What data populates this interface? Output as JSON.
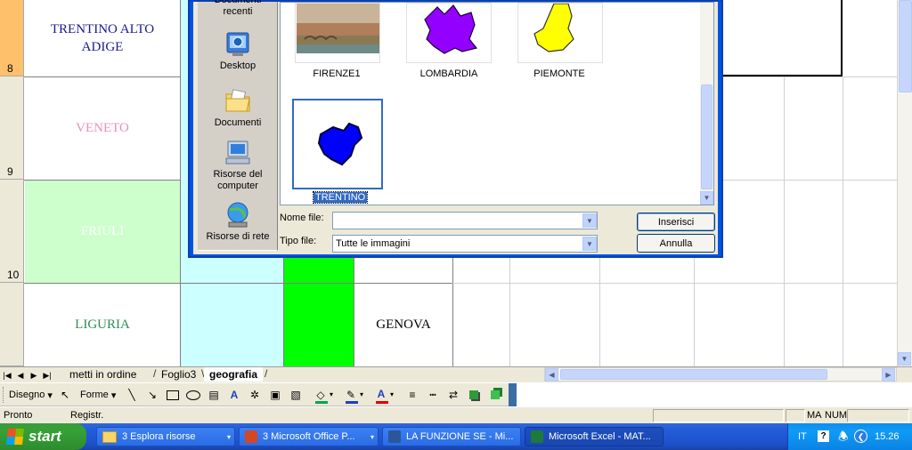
{
  "sheet": {
    "rows": [
      {
        "number": "8",
        "region": "TRENTINO ALTO ADIGE",
        "region_color": "#1a1a8c",
        "fill": "#ffffff"
      },
      {
        "number": "9",
        "region": "VENETO",
        "region_color": "#e88fc0",
        "fill": "#ffffff"
      },
      {
        "number": "10",
        "region": "FRIULI",
        "region_color": "#ffffff",
        "fill": "#ccffcc"
      },
      {
        "number": "",
        "region": "LIGURIA",
        "region_color": "#2e8b57",
        "fill": "#ffffff"
      }
    ],
    "capital_liguria": "GENOVA",
    "colors": {
      "cyan_col": "#ccffff",
      "green_cell": "#00ff00",
      "row8_header": "#ffc06b"
    }
  },
  "dialog": {
    "places": [
      {
        "label": "Documenti recenti",
        "icon": "recent-documents-icon"
      },
      {
        "label": "Desktop",
        "icon": "desktop-icon"
      },
      {
        "label": "Documenti",
        "icon": "documents-folder-icon"
      },
      {
        "label": "Risorse del computer",
        "icon": "my-computer-icon"
      },
      {
        "label": "Risorse di rete",
        "icon": "network-icon"
      }
    ],
    "files": [
      {
        "label": "FIRENZE1",
        "icon": "florence-photo-thumbnail"
      },
      {
        "label": "LOMBARDIA",
        "icon": "lombardia-map-thumbnail",
        "color": "#9400ff"
      },
      {
        "label": "PIEMONTE",
        "icon": "piemonte-map-thumbnail",
        "color": "#ffff00"
      },
      {
        "label": "TRENTINO",
        "icon": "trentino-map-thumbnail",
        "color": "#0000ff",
        "selected": true
      }
    ],
    "filename_label": "Nome file:",
    "filename_value": "",
    "filetype_label": "Tipo file:",
    "filetype_value": "Tutte le immagini",
    "insert_button": "Inserisci",
    "cancel_button": "Annulla"
  },
  "tabs": {
    "items": [
      {
        "label": "metti in ordine",
        "active": false
      },
      {
        "label": "Foglio3",
        "active": false
      },
      {
        "label": "geografia",
        "active": true
      }
    ]
  },
  "drawbar": {
    "draw_menu": "Disegno",
    "shapes_menu": "Forme",
    "icons": [
      "select-objects-icon",
      "line-icon",
      "arrow-icon",
      "rectangle-icon",
      "oval-icon",
      "textbox-icon",
      "wordart-icon",
      "diagram-icon",
      "clipart-icon",
      "insert-picture-icon",
      "fill-color-icon",
      "line-color-icon",
      "font-color-icon",
      "line-style-icon",
      "dash-style-icon",
      "arrow-style-icon",
      "shadow-icon",
      "3d-icon"
    ],
    "colors": {
      "fill": "#00a651",
      "line": "#1f3fbf",
      "font": "#e00000"
    }
  },
  "status": {
    "left": "Pronto",
    "mode": "Registr.",
    "caps": "MA",
    "num": "NUM"
  },
  "taskbar": {
    "start": "start",
    "tasks": [
      {
        "label": "3 Esplora risorse",
        "icon": "folder-icon",
        "active": false
      },
      {
        "label": "3 Microsoft Office P...",
        "icon": "powerpoint-icon",
        "active": false
      },
      {
        "label": "LA FUNZIONE SE - Mi...",
        "icon": "word-icon",
        "active": false
      },
      {
        "label": "Microsoft Excel - MAT...",
        "icon": "excel-icon",
        "active": true
      }
    ],
    "tray": {
      "lang": "IT",
      "time": "15.26"
    }
  }
}
